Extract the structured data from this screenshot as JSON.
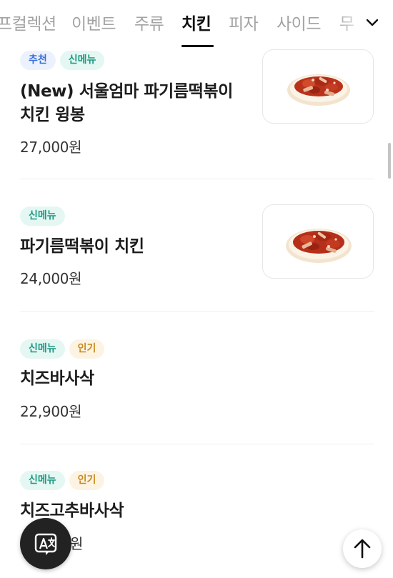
{
  "category_tabs": {
    "items": [
      {
        "label": "프컬렉션"
      },
      {
        "label": "이벤트"
      },
      {
        "label": "주류"
      },
      {
        "label": "치킨",
        "active": true
      },
      {
        "label": "피자"
      },
      {
        "label": "사이드"
      },
      {
        "label": "무"
      }
    ],
    "more_icon": "chevron-down-icon"
  },
  "menu_items": [
    {
      "badges": [
        {
          "label": "추천",
          "type": "recommend"
        },
        {
          "label": "신메뉴",
          "type": "new"
        }
      ],
      "name": "(New) 서울엄마 파기름떡볶이 치킨 윙봉",
      "price": "27,000원",
      "has_image": true
    },
    {
      "badges": [
        {
          "label": "신메뉴",
          "type": "new"
        }
      ],
      "name": "파기름떡볶이 치킨",
      "price": "24,000원",
      "has_image": true
    },
    {
      "badges": [
        {
          "label": "신메뉴",
          "type": "new"
        },
        {
          "label": "인기",
          "type": "popular"
        }
      ],
      "name": "치즈바사삭",
      "price": "22,900원",
      "has_image": false
    },
    {
      "badges": [
        {
          "label": "신메뉴",
          "type": "new"
        },
        {
          "label": "인기",
          "type": "popular"
        }
      ],
      "name": "치즈고추바사삭",
      "price": "원",
      "has_image": false
    }
  ],
  "floating": {
    "translate_icon": "translate-icon",
    "scroll_top_icon": "arrow-up-icon"
  },
  "colors": {
    "badge_recommend_bg": "#ecf2fd",
    "badge_recommend_text": "#3a6fd8",
    "badge_new_bg": "#e4f7f3",
    "badge_new_text": "#1f9a82",
    "badge_popular_bg": "#fdf3e2",
    "badge_popular_text": "#c98a1e",
    "active_tab": "#111111",
    "inactive_tab": "#a3a3a3"
  }
}
